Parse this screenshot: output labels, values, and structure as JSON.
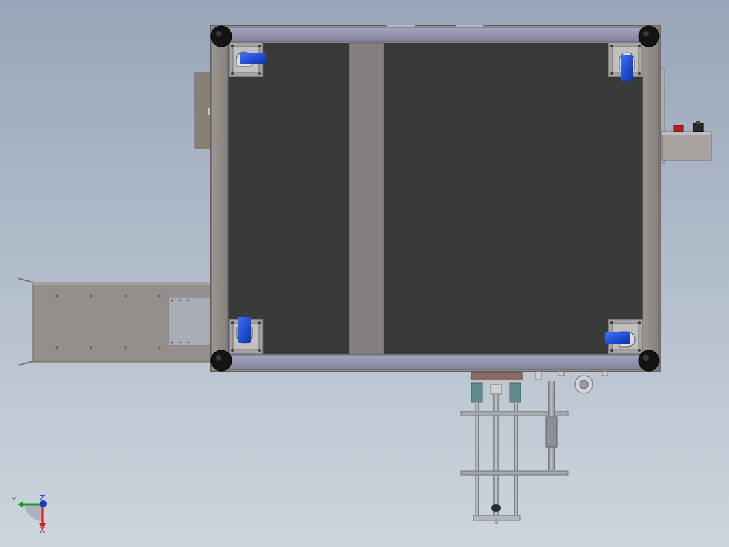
{
  "view": {
    "background_top": "#98a6b9",
    "background_bottom": "#cdd5dd"
  },
  "model": {
    "frame_color": "#8f8a86",
    "panel_color": "#3a3a3a",
    "rail_color": "#8a8aa0",
    "caster_color": "#1a4fd6",
    "wheel_color": "#141414"
  },
  "triad": {
    "y_label": "Y",
    "z_label": "Z",
    "x_label": "X",
    "y_color": "#1aa01a",
    "z_color": "#1a3ad6",
    "x_color": "#d61a1a"
  }
}
